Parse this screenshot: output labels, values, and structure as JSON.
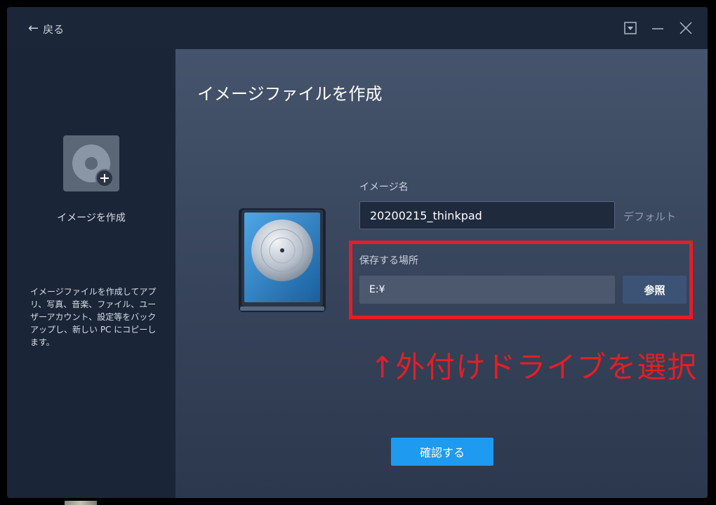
{
  "titlebar": {
    "back_label": "戻る"
  },
  "sidebar": {
    "label": "イメージを作成",
    "description": "イメージファイルを作成してアプリ、写真、音楽、ファイル、ユーザーアカウント、設定等をバックアップし、新しい PC にコピーします。"
  },
  "main": {
    "title": "イメージファイルを作成",
    "image_name_label": "イメージ名",
    "image_name_value": "20200215_thinkpad",
    "default_link": "デフォルト",
    "location_label": "保存する場所",
    "location_value": "E:¥",
    "browse_button": "参照",
    "annotation": "↑外付けドライブを選択",
    "confirm_button": "確認する"
  },
  "colors": {
    "accent": "#1e9af0",
    "annotation_red": "#e41e26",
    "browse_button": "#3d5375"
  },
  "icons": [
    "back-arrow-icon",
    "dropdown-menu-icon",
    "minimize-icon",
    "close-icon",
    "create-image-icon",
    "disk-image-icon"
  ]
}
